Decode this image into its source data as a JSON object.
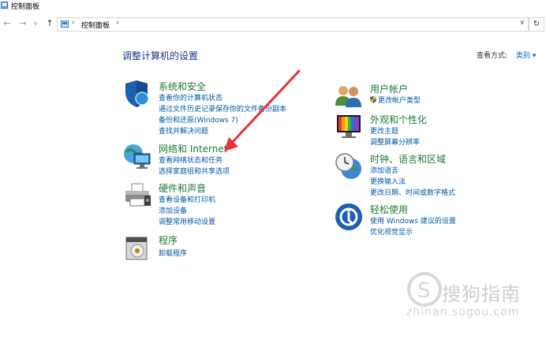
{
  "window": {
    "title": "控制面板"
  },
  "address": {
    "crumb": "控制面板",
    "sep1": "›",
    "sep2": "›"
  },
  "nav": {
    "back": "←",
    "forward": "→",
    "up": "↑",
    "dropdown": "∨",
    "refresh": "↻"
  },
  "heading": "调整计算机的设置",
  "view_by": {
    "label": "查看方式:",
    "value": "类别 ▾"
  },
  "left": [
    {
      "title": "系统和安全",
      "icon": "shield-icon",
      "links": [
        "查看你的计算机状态",
        "通过文件历史记录保存你的文件备份副本",
        "备份和还原(Windows 7)",
        "查找并解决问题"
      ]
    },
    {
      "title": "网络和 Internet",
      "icon": "network-icon",
      "links": [
        "查看网络状态和任务",
        "选择家庭组和共享选项"
      ]
    },
    {
      "title": "硬件和声音",
      "icon": "printer-icon",
      "links": [
        "查看设备和打印机",
        "添加设备",
        "调整常用移动设置"
      ]
    },
    {
      "title": "程序",
      "icon": "programs-icon",
      "links": [
        "卸载程序"
      ]
    }
  ],
  "right": [
    {
      "title": "用户帐户",
      "icon": "users-icon",
      "links": [
        "更改帐户类型"
      ]
    },
    {
      "title": "外观和个性化",
      "icon": "appearance-icon",
      "links": [
        "更改主题",
        "调整屏幕分辨率"
      ]
    },
    {
      "title": "时钟、语言和区域",
      "icon": "clock-globe-icon",
      "links": [
        "添加语言",
        "更换输入法",
        "更改日期、时间或数字格式"
      ]
    },
    {
      "title": "轻松使用",
      "icon": "ease-of-access-icon",
      "links": [
        "使用 Windows 建议的设置",
        "优化视觉显示"
      ]
    }
  ],
  "watermark": {
    "text": "搜狗指南",
    "url": "zhinan.sogou.com"
  },
  "colors": {
    "heading": "#1e3287",
    "category": "#1e7a34",
    "link": "#0058a8",
    "arrow": "#e8323c"
  }
}
